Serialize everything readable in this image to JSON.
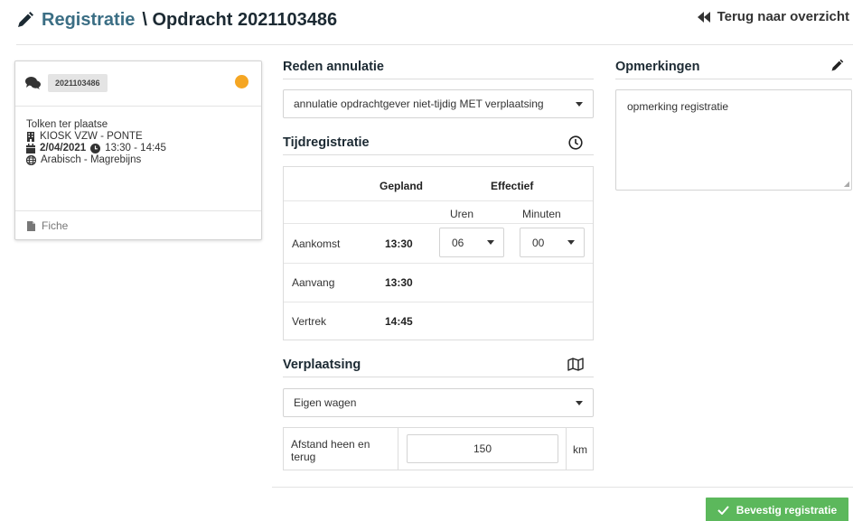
{
  "header": {
    "title_part1": "Registratie",
    "title_part2": "\\ Opdracht 2021103486",
    "back_label": "Terug naar overzicht"
  },
  "card": {
    "badge": "2021103486",
    "status_color": "#f5a623",
    "type": "Tolken ter plaatse",
    "organisation": "KIOSK VZW - PONTE",
    "date": "2/04/2021",
    "time": "13:30 - 14:45",
    "language": "Arabisch - Magrebijns",
    "fiche_label": "Fiche"
  },
  "cancellation": {
    "title": "Reden annulatie",
    "selected": "annulatie opdrachtgever niet-tijdig MET verplaatsing"
  },
  "time_registration": {
    "title": "Tijdregistratie",
    "col_planned": "Gepland",
    "col_effective": "Effectief",
    "col_hours": "Uren",
    "col_minutes": "Minuten",
    "rows": [
      {
        "label": "Aankomst",
        "planned": "13:30",
        "hours": "06",
        "minutes": "00"
      },
      {
        "label": "Aanvang",
        "planned": "13:30"
      },
      {
        "label": "Vertrek",
        "planned": "14:45"
      }
    ]
  },
  "travel": {
    "title": "Verplaatsing",
    "selected": "Eigen wagen",
    "distance_label": "Afstand heen en terug",
    "distance_value": "150",
    "distance_unit": "km"
  },
  "remarks": {
    "title": "Opmerkingen",
    "value": "opmerking registratie"
  },
  "confirm_label": "Bevestig registratie",
  "colors": {
    "primary_title": "#3b6e84",
    "confirm": "#5cb85c"
  }
}
